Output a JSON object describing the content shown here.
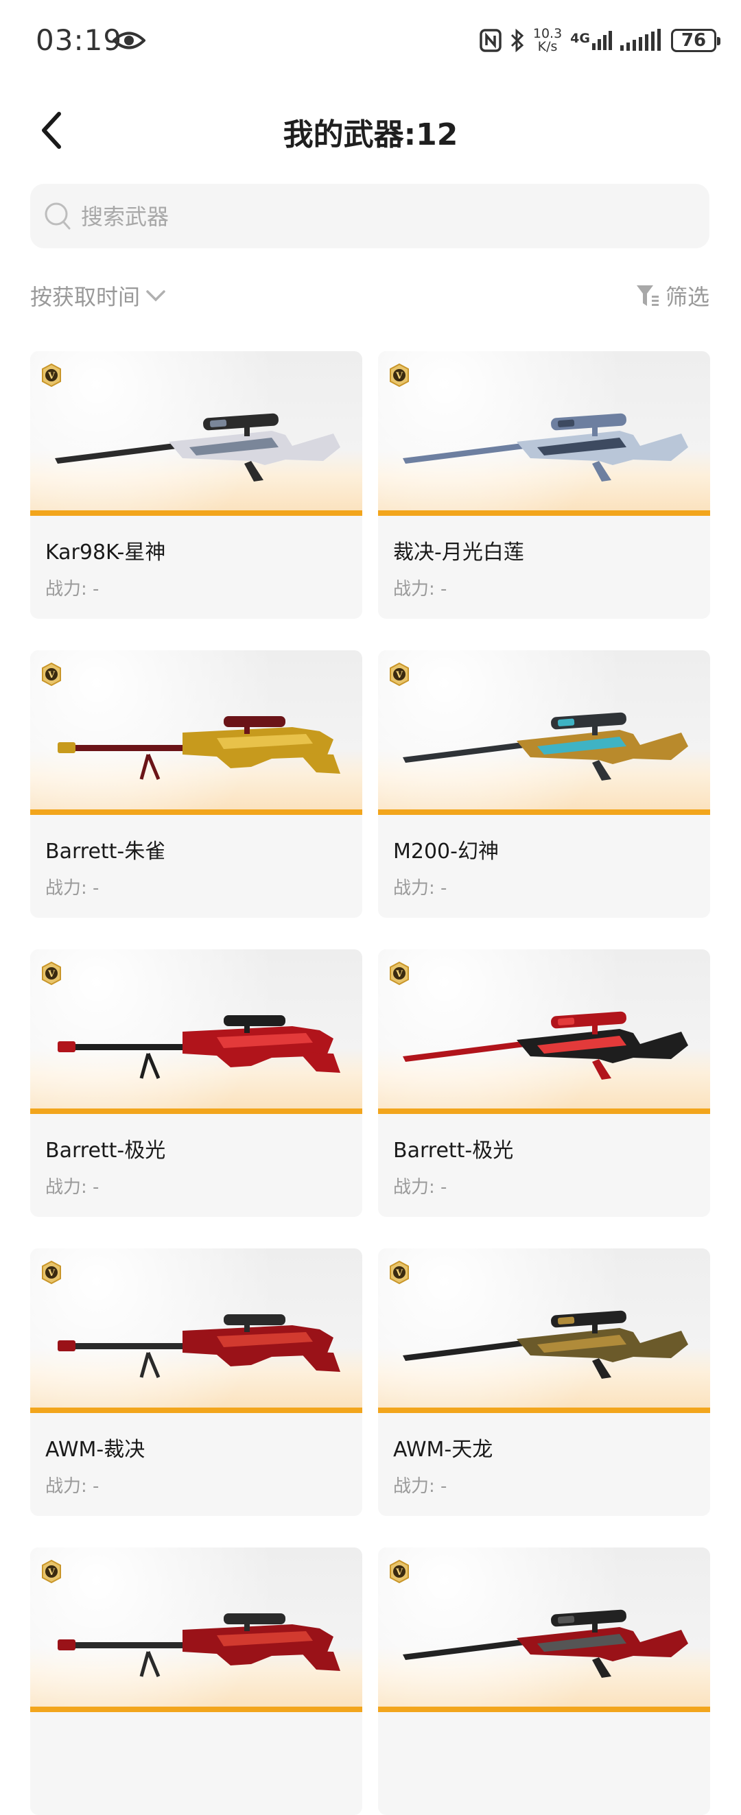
{
  "status_bar": {
    "time": "03:19",
    "speed_top": "10.3",
    "speed_bottom": "K/s",
    "network": "4G",
    "battery": "76"
  },
  "header": {
    "title": "我的武器:12"
  },
  "search": {
    "placeholder": "搜索武器"
  },
  "toolbar": {
    "sort_label": "按获取时间",
    "filter_label": "筛选"
  },
  "accent_color": "#f2a51c",
  "weapons": [
    {
      "name": "Kar98K-星神",
      "power": "战力: -",
      "colors": [
        "#2b2b2b",
        "#d8d8e0",
        "#7a8699"
      ]
    },
    {
      "name": "裁决-月光白莲",
      "power": "战力: -",
      "colors": [
        "#6d7fa0",
        "#b9c6d8",
        "#3d4a60"
      ]
    },
    {
      "name": "Barrett-朱雀",
      "power": "战力: -",
      "colors": [
        "#c79a1d",
        "#6b1418",
        "#e8c24a"
      ]
    },
    {
      "name": "M200-幻神",
      "power": "战力: -",
      "colors": [
        "#2f3337",
        "#b98a2c",
        "#3fb3c4"
      ]
    },
    {
      "name": "Barrett-极光",
      "power": "战力: -",
      "colors": [
        "#b1141b",
        "#1e1e1e",
        "#e33a3a"
      ]
    },
    {
      "name": "Barrett-极光",
      "power": "战力: -",
      "colors": [
        "#b1141b",
        "#1e1e1e",
        "#e33a3a"
      ]
    },
    {
      "name": "AWM-裁决",
      "power": "战力: -",
      "colors": [
        "#9a1218",
        "#2a2a2a",
        "#d23a2f"
      ]
    },
    {
      "name": "AWM-天龙",
      "power": "战力: -",
      "colors": [
        "#222222",
        "#6b5a2a",
        "#b08b3a"
      ]
    },
    {
      "name": "",
      "power": "",
      "colors": [
        "#9a1218",
        "#2a2a2a",
        "#d23a2f"
      ]
    },
    {
      "name": "",
      "power": "",
      "colors": [
        "#222222",
        "#9a1218",
        "#555555"
      ]
    }
  ]
}
